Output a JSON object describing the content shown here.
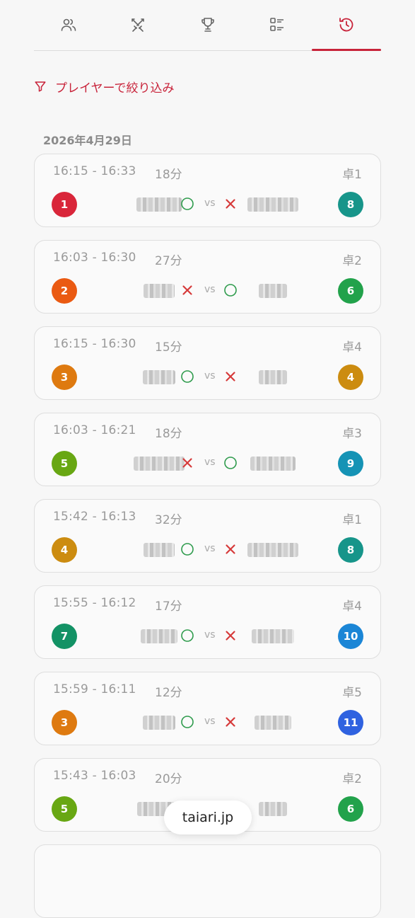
{
  "tabs": [
    {
      "icon": "players-icon",
      "active": false
    },
    {
      "icon": "swords-icon",
      "active": false
    },
    {
      "icon": "trophy-icon",
      "active": false
    },
    {
      "icon": "list-icon",
      "active": false
    },
    {
      "icon": "history-icon",
      "active": true
    }
  ],
  "filter": {
    "label": "プレイヤーで絞り込み",
    "icon": "filter-icon"
  },
  "date_header": "2026年4月29日",
  "matches": [
    {
      "time": "16:15 - 16:33",
      "duration": "18分",
      "table": "卓1",
      "left_seat": "1",
      "left_color": "#d9263a",
      "right_seat": "8",
      "right_color": "#17958a",
      "left_result": "win",
      "right_result": "loss"
    },
    {
      "time": "16:03 - 16:30",
      "duration": "27分",
      "table": "卓2",
      "left_seat": "2",
      "left_color": "#ea5a12",
      "right_seat": "6",
      "right_color": "#22a24b",
      "left_result": "loss",
      "right_result": "win"
    },
    {
      "time": "16:15 - 16:30",
      "duration": "15分",
      "table": "卓4",
      "left_seat": "3",
      "left_color": "#de7a10",
      "right_seat": "4",
      "right_color": "#cc8c10",
      "left_result": "win",
      "right_result": "loss"
    },
    {
      "time": "16:03 - 16:21",
      "duration": "18分",
      "table": "卓3",
      "left_seat": "5",
      "left_color": "#68a713",
      "right_seat": "9",
      "right_color": "#1593b5",
      "left_result": "loss",
      "right_result": "win"
    },
    {
      "time": "15:42 - 16:13",
      "duration": "32分",
      "table": "卓1",
      "left_seat": "4",
      "left_color": "#cc8c10",
      "right_seat": "8",
      "right_color": "#17958a",
      "left_result": "win",
      "right_result": "loss"
    },
    {
      "time": "15:55 - 16:12",
      "duration": "17分",
      "table": "卓4",
      "left_seat": "7",
      "left_color": "#139265",
      "right_seat": "10",
      "right_color": "#1b86d6",
      "left_result": "win",
      "right_result": "loss"
    },
    {
      "time": "15:59 - 16:11",
      "duration": "12分",
      "table": "卓5",
      "left_seat": "3",
      "left_color": "#de7a10",
      "right_seat": "11",
      "right_color": "#2f62e0",
      "left_result": "win",
      "right_result": "loss"
    },
    {
      "time": "15:43 - 16:03",
      "duration": "20分",
      "table": "卓2",
      "left_seat": "5",
      "left_color": "#68a713",
      "right_seat": "6",
      "right_color": "#22a24b",
      "left_result": "loss",
      "right_result": "win"
    }
  ],
  "vs_label": "vs",
  "watermark": "taiari.jp",
  "colors": {
    "accent": "#c8233a",
    "win": "#2e9b4c",
    "loss": "#d63a3a"
  }
}
